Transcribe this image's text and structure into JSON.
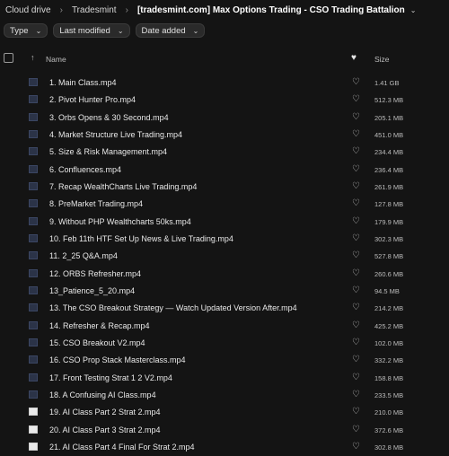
{
  "breadcrumb": {
    "items": [
      "Cloud drive",
      "Tradesmint",
      "[tradesmint.com] Max Options Trading - CSO Trading Battalion"
    ]
  },
  "filters": [
    "Type",
    "Last modified",
    "Date added"
  ],
  "table": {
    "columns": {
      "name": "Name",
      "size": "Size"
    },
    "rows": [
      {
        "name": "1. Main Class.mp4",
        "size": "1.41 GB",
        "thumb": "dark"
      },
      {
        "name": "2. Pivot Hunter Pro.mp4",
        "size": "512.3 MB",
        "thumb": "dark"
      },
      {
        "name": "3. Orbs Opens & 30 Second.mp4",
        "size": "205.1 MB",
        "thumb": "dark"
      },
      {
        "name": "4. Market Structure Live Trading.mp4",
        "size": "451.0 MB",
        "thumb": "dark"
      },
      {
        "name": "5. Size & Risk Management.mp4",
        "size": "234.4 MB",
        "thumb": "dark"
      },
      {
        "name": "6. Confluences.mp4",
        "size": "236.4 MB",
        "thumb": "dark"
      },
      {
        "name": "7. Recap WealthCharts Live Trading.mp4",
        "size": "261.9 MB",
        "thumb": "dark"
      },
      {
        "name": "8. PreMarket Trading.mp4",
        "size": "127.8 MB",
        "thumb": "dark"
      },
      {
        "name": "9. Without PHP Wealthcharts 50ks.mp4",
        "size": "179.9 MB",
        "thumb": "dark"
      },
      {
        "name": "10. Feb 11th HTF Set Up News & Live Trading.mp4",
        "size": "302.3 MB",
        "thumb": "dark"
      },
      {
        "name": "11. 2_25 Q&A.mp4",
        "size": "527.8 MB",
        "thumb": "dark"
      },
      {
        "name": "12. ORBS Refresher.mp4",
        "size": "260.6 MB",
        "thumb": "dark"
      },
      {
        "name": "13_Patience_5_20.mp4",
        "size": "94.5 MB",
        "thumb": "dark"
      },
      {
        "name": "13. The CSO Breakout Strategy — Watch Updated Version After.mp4",
        "size": "214.2 MB",
        "thumb": "dark"
      },
      {
        "name": "14. Refresher & Recap.mp4",
        "size": "425.2 MB",
        "thumb": "dark"
      },
      {
        "name": "15. CSO Breakout V2.mp4",
        "size": "102.0 MB",
        "thumb": "dark"
      },
      {
        "name": "16. CSO Prop Stack Masterclass.mp4",
        "size": "332.2 MB",
        "thumb": "dark"
      },
      {
        "name": "17. Front Testing Strat 1 2 V2.mp4",
        "size": "158.8 MB",
        "thumb": "dark"
      },
      {
        "name": "18. A Confusing AI Class.mp4",
        "size": "233.5 MB",
        "thumb": "dark"
      },
      {
        "name": "19. AI Class Part 2 Strat 2.mp4",
        "size": "210.0 MB",
        "thumb": "light"
      },
      {
        "name": "20. AI Class Part 3 Strat 2.mp4",
        "size": "372.6 MB",
        "thumb": "light"
      },
      {
        "name": "21. AI Class Part 4 Final For Strat 2.mp4",
        "size": "302.8 MB",
        "thumb": "light"
      }
    ]
  }
}
